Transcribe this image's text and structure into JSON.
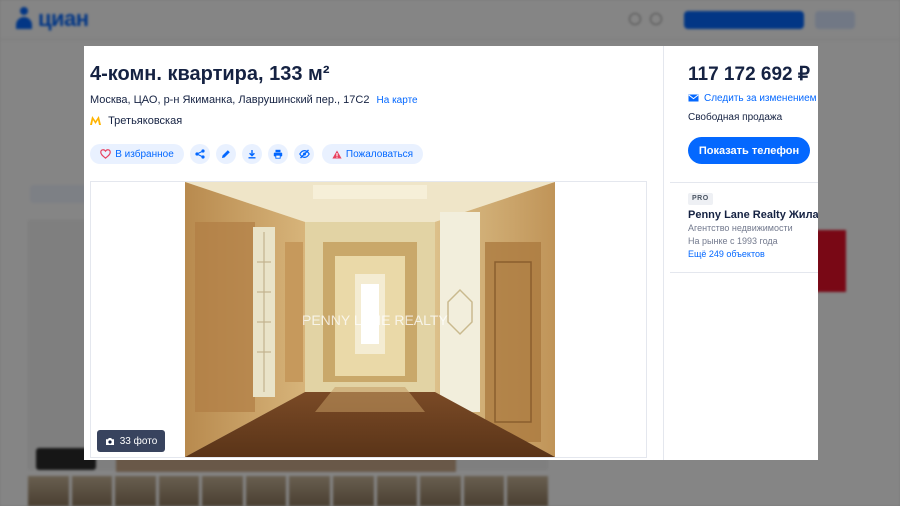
{
  "colors": {
    "accent": "#0468ff",
    "text": "#152242",
    "complain": "#e84260",
    "metro": "#ffb400"
  },
  "modal": {
    "title": "4-комн. квартира, 133 м²",
    "address": "Москва, ЦАО, р-н Якиманка, Лаврушинский пер., 17С2",
    "map_link": "На карте",
    "metro": {
      "icon": "metro-icon",
      "station": "Третьяковская"
    },
    "actions": {
      "favorite": {
        "icon": "heart-icon",
        "label": "В избранное"
      },
      "share": {
        "icon": "share-icon"
      },
      "note": {
        "icon": "pencil-icon"
      },
      "download": {
        "icon": "download-icon"
      },
      "print": {
        "icon": "print-icon"
      },
      "hide": {
        "icon": "eye-off-icon"
      },
      "complain": {
        "icon": "warning-icon",
        "label": "Пожаловаться"
      }
    },
    "gallery": {
      "watermark": "PENNY LANE REALTY",
      "photo_count_icon": "camera-icon",
      "photo_count": "33 фото"
    }
  },
  "side": {
    "price": "117 172 692 ₽",
    "follow_icon": "mail-icon",
    "follow_label": "Следить за изменением ц",
    "sale_type": "Свободная продажа",
    "phone_button": "Показать телефон",
    "agent": {
      "badge": "PRO",
      "name": "Penny Lane Realty Жилая",
      "type": "Агентство недвижимости",
      "years": "На рынке с 1993 года",
      "more_link": "Ещё 249 объектов"
    }
  }
}
